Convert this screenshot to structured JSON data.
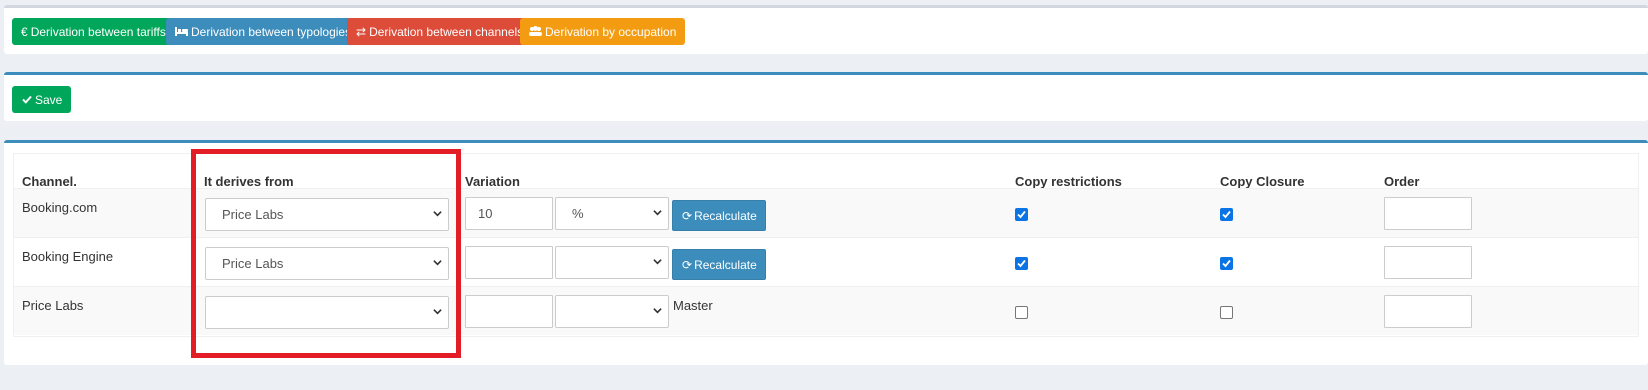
{
  "toolbar": {
    "buttons": [
      {
        "label": "Derivation between tariffs",
        "icon": "euro-icon",
        "color": "#00a65a"
      },
      {
        "label": "Derivation between typologies",
        "icon": "bed-icon",
        "color": "#3c8dbc"
      },
      {
        "label": "Derivation between channels",
        "icon": "exchange-icon",
        "color": "#dd4b39"
      },
      {
        "label": "Derivation by occupation",
        "icon": "users-icon",
        "color": "#f39c12"
      }
    ]
  },
  "actions": {
    "save_label": "Save",
    "save_icon": "check-icon"
  },
  "table": {
    "headers": {
      "channel": "Channel.",
      "derives_from": "It derives from",
      "variation": "Variation",
      "copy_restrictions": "Copy restrictions",
      "copy_closure": "Copy Closure",
      "order": "Order"
    },
    "rows": [
      {
        "channel": "Booking.com",
        "derives_from": "Price Labs",
        "variation_value": "10",
        "variation_unit": "%",
        "action_label": "Recalculate",
        "note": "",
        "copy_restrictions": true,
        "copy_closure": true,
        "order": ""
      },
      {
        "channel": "Booking Engine",
        "derives_from": "Price Labs",
        "variation_value": "",
        "variation_unit": "",
        "action_label": "Recalculate",
        "note": "",
        "copy_restrictions": true,
        "copy_closure": true,
        "order": ""
      },
      {
        "channel": "Price Labs",
        "derives_from": "",
        "variation_value": "",
        "variation_unit": "",
        "action_label": "",
        "note": "Master",
        "copy_restrictions": false,
        "copy_closure": false,
        "order": ""
      }
    ]
  },
  "colors": {
    "accent": "#3c8dbc",
    "highlight": "#e21d25",
    "checkbox": "#0b74e5"
  }
}
